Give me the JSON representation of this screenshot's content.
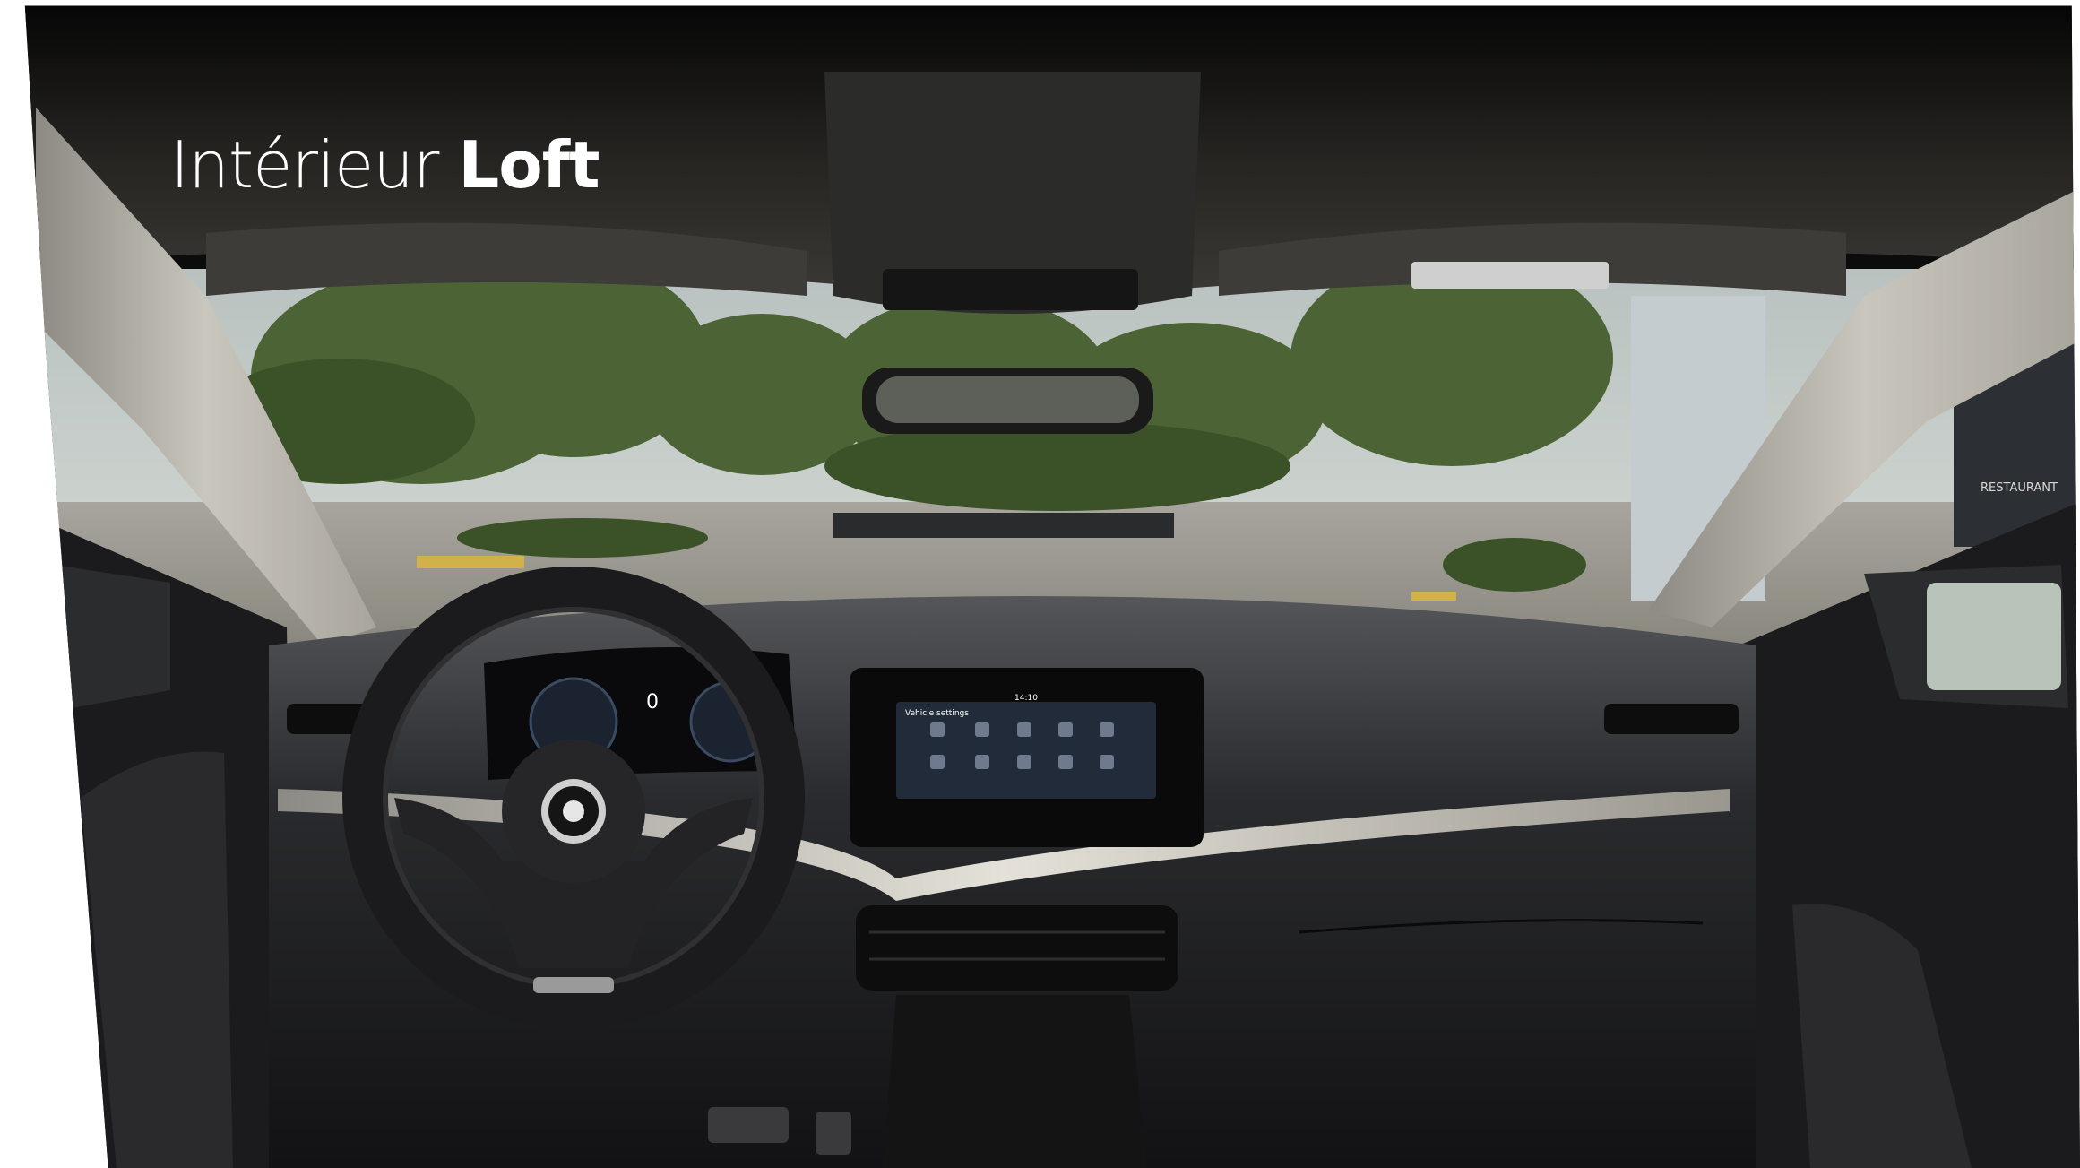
{
  "heading": {
    "prefix": "Intérieur",
    "emphasis": "Loft"
  },
  "infotainment": {
    "header": "Vehicle settings",
    "clock": "14:10"
  },
  "instrument_cluster": {
    "speed": "0"
  },
  "scene": {
    "building_sign": "RESTAURANT"
  },
  "colors": {
    "interior_dark": "#1d1e20",
    "headliner": "#3a3935",
    "pillar": "#c9c6bd",
    "trim_silver": "#d9d6cd",
    "foliage": "#4c6435",
    "sky": "#b9c2c0",
    "screen": "#222b3a"
  }
}
